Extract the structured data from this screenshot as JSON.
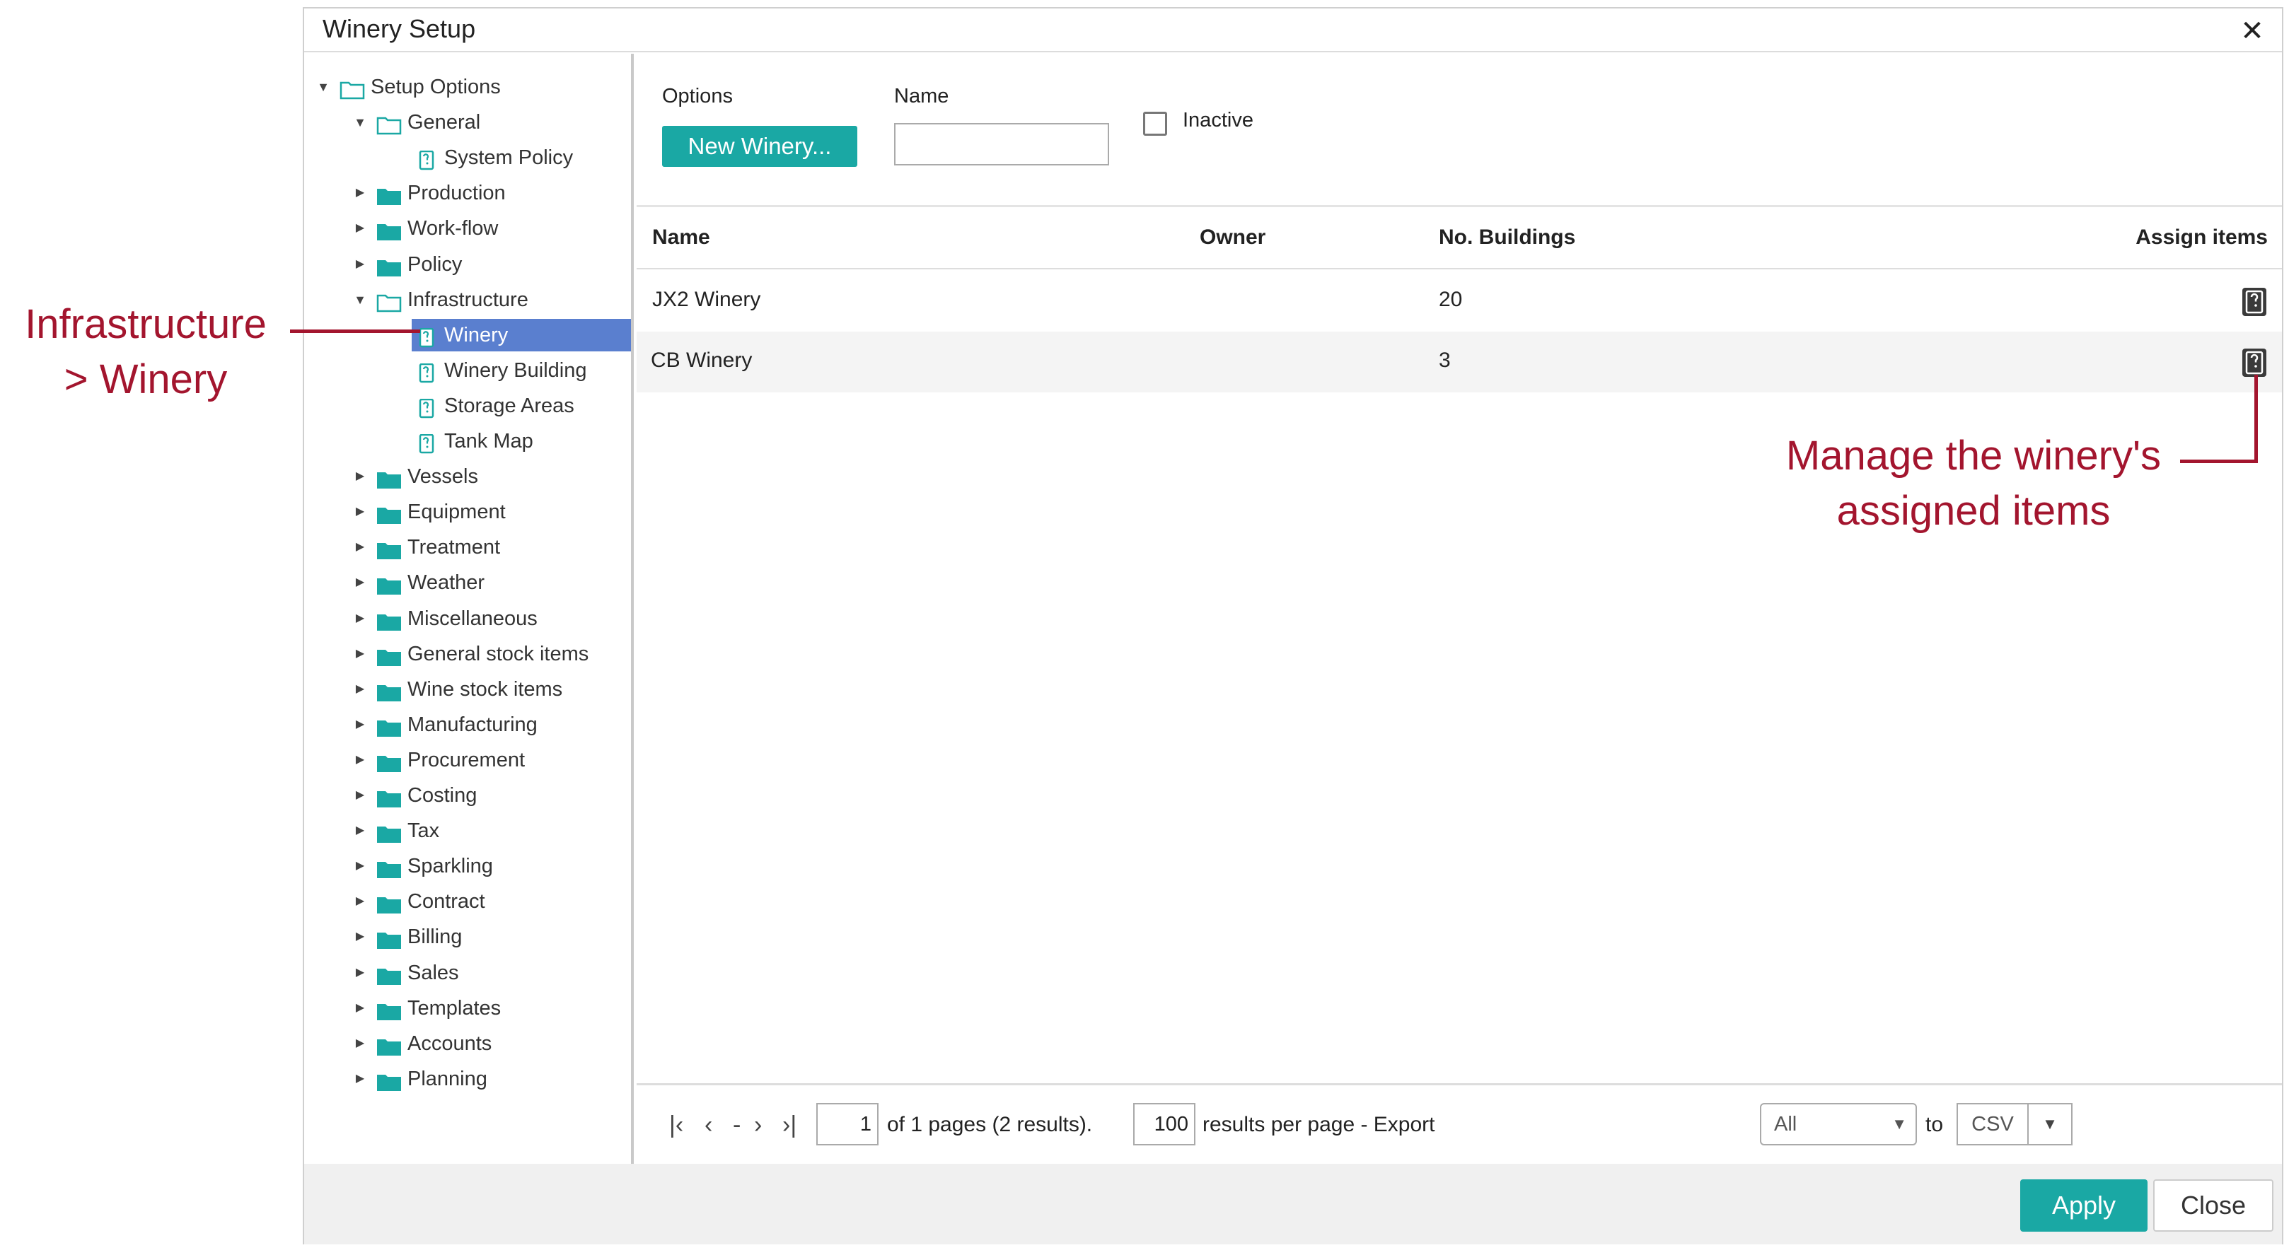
{
  "window": {
    "title": "Winery Setup"
  },
  "tree": [
    {
      "label": "Setup Options",
      "level": 0,
      "expander": "open",
      "icon": "folder-open-icon"
    },
    {
      "label": "General",
      "level": 1,
      "expander": "open",
      "icon": "folder-open-icon"
    },
    {
      "label": "System Policy",
      "level": 2,
      "expander": "none",
      "icon": "document-icon"
    },
    {
      "label": "Production",
      "level": 1,
      "expander": "closed",
      "icon": "folder-icon"
    },
    {
      "label": "Work-flow",
      "level": 1,
      "expander": "closed",
      "icon": "folder-icon"
    },
    {
      "label": "Policy",
      "level": 1,
      "expander": "closed",
      "icon": "folder-icon"
    },
    {
      "label": "Infrastructure",
      "level": 1,
      "expander": "open",
      "icon": "folder-open-icon"
    },
    {
      "label": "Winery",
      "level": 2,
      "expander": "none",
      "icon": "document-icon",
      "selected": true
    },
    {
      "label": "Winery Building",
      "level": 2,
      "expander": "none",
      "icon": "document-icon"
    },
    {
      "label": "Storage Areas",
      "level": 2,
      "expander": "none",
      "icon": "document-icon"
    },
    {
      "label": "Tank Map",
      "level": 2,
      "expander": "none",
      "icon": "document-icon"
    },
    {
      "label": "Vessels",
      "level": 1,
      "expander": "closed",
      "icon": "folder-icon"
    },
    {
      "label": "Equipment",
      "level": 1,
      "expander": "closed",
      "icon": "folder-icon"
    },
    {
      "label": "Treatment",
      "level": 1,
      "expander": "closed",
      "icon": "folder-icon"
    },
    {
      "label": "Weather",
      "level": 1,
      "expander": "closed",
      "icon": "folder-icon"
    },
    {
      "label": "Miscellaneous",
      "level": 1,
      "expander": "closed",
      "icon": "folder-icon"
    },
    {
      "label": "General stock items",
      "level": 1,
      "expander": "closed",
      "icon": "folder-icon"
    },
    {
      "label": "Wine stock items",
      "level": 1,
      "expander": "closed",
      "icon": "folder-icon"
    },
    {
      "label": "Manufacturing",
      "level": 1,
      "expander": "closed",
      "icon": "folder-icon"
    },
    {
      "label": "Procurement",
      "level": 1,
      "expander": "closed",
      "icon": "folder-icon"
    },
    {
      "label": "Costing",
      "level": 1,
      "expander": "closed",
      "icon": "folder-icon"
    },
    {
      "label": "Tax",
      "level": 1,
      "expander": "closed",
      "icon": "folder-icon"
    },
    {
      "label": "Sparkling",
      "level": 1,
      "expander": "closed",
      "icon": "folder-icon"
    },
    {
      "label": "Contract",
      "level": 1,
      "expander": "closed",
      "icon": "folder-icon"
    },
    {
      "label": "Billing",
      "level": 1,
      "expander": "closed",
      "icon": "folder-icon"
    },
    {
      "label": "Sales",
      "level": 1,
      "expander": "closed",
      "icon": "folder-icon"
    },
    {
      "label": "Templates",
      "level": 1,
      "expander": "closed",
      "icon": "folder-icon"
    },
    {
      "label": "Accounts",
      "level": 1,
      "expander": "closed",
      "icon": "folder-icon"
    },
    {
      "label": "Planning",
      "level": 1,
      "expander": "closed",
      "icon": "folder-icon"
    }
  ],
  "filters": {
    "options_label": "Options",
    "new_button": "New Winery...",
    "name_label": "Name",
    "name_value": "",
    "inactive_label": "Inactive",
    "inactive_checked": false
  },
  "table": {
    "columns": [
      "Name",
      "Owner",
      "No. Buildings",
      "Assign items"
    ],
    "rows": [
      {
        "name": "JX2 Winery",
        "owner": "",
        "buildings": "20"
      },
      {
        "name": "CB Winery",
        "owner": "",
        "buildings": "3"
      }
    ]
  },
  "pager": {
    "dash": "-",
    "page": "1",
    "of_text": "of 1 pages (2 results).",
    "per_page": "100",
    "per_page_text": "results per page - Export",
    "export_scope": "All",
    "to_text": "to",
    "format": "CSV"
  },
  "actions": {
    "apply": "Apply",
    "close": "Close"
  },
  "annotations": {
    "left_line1": "Infrastructure",
    "left_line2": "> Winery",
    "right_line1": "Manage the winery's",
    "right_line2": "assigned items"
  },
  "colors": {
    "accent": "#1aa8a4",
    "selection": "#5a7fcf",
    "annotation": "#a3152e",
    "folder": "#1aa8a4"
  }
}
